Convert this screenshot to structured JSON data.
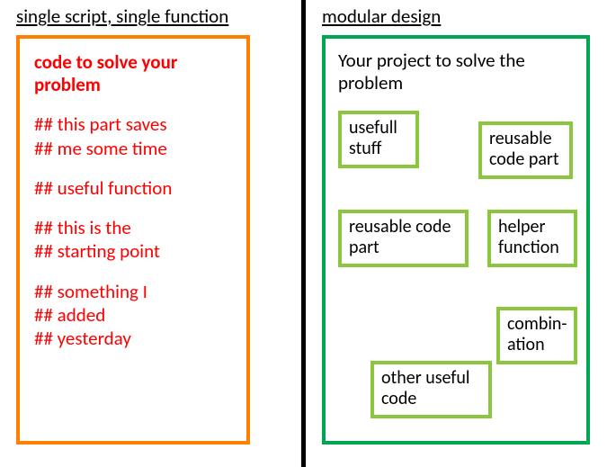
{
  "left": {
    "heading": "single script, single function",
    "title": "code to solve your problem",
    "comments": [
      "## this part saves\n## me some time",
      "## useful function",
      "## this is the\n## starting point",
      "## something I\n## added\n## yesterday"
    ]
  },
  "right": {
    "heading": "modular design",
    "title": "Your project to solve the problem",
    "modules": {
      "usefull": "usefull stuff",
      "reusable1": "reusable code part",
      "reusable2": "reusable code part",
      "helper": "helper function",
      "combin": "combin-ation",
      "other": "other useful code"
    }
  }
}
